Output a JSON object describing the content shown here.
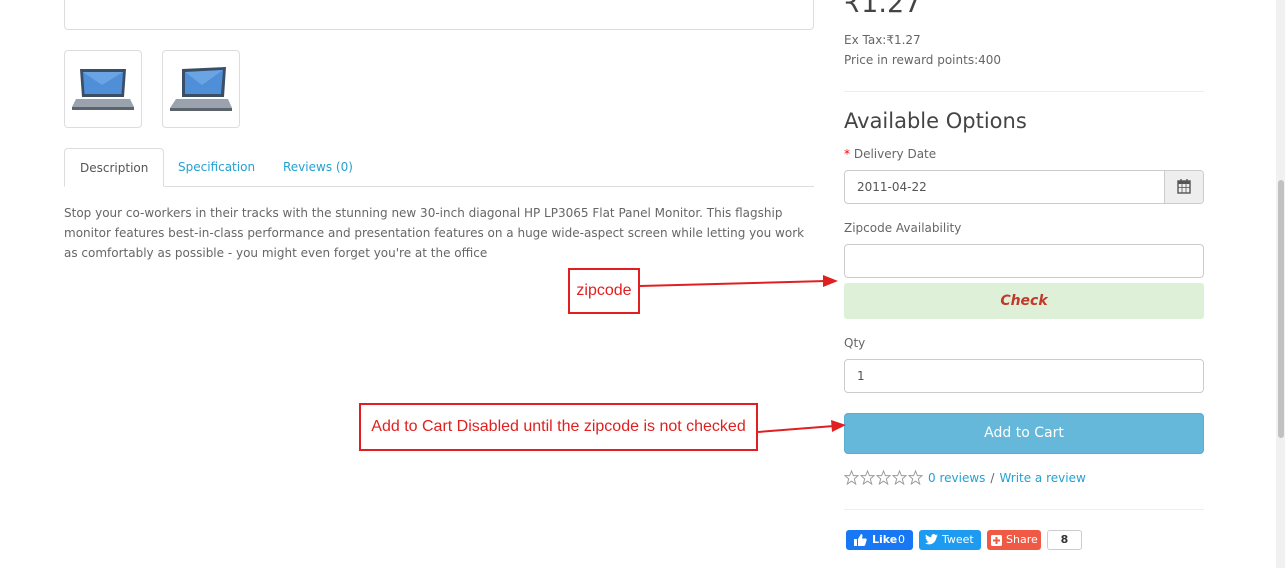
{
  "gallery": {
    "thumb_icon_1": "laptop-icon",
    "thumb_icon_2": "laptop-icon"
  },
  "tabs": [
    {
      "label": "Description",
      "active": true
    },
    {
      "label": "Specification",
      "active": false
    },
    {
      "label": "Reviews (0)",
      "active": false
    }
  ],
  "description": "Stop your co-workers in their tracks with the stunning new 30-inch diagonal HP LP3065 Flat Panel Monitor. This flagship monitor features best-in-class performance and presentation features on a huge wide-aspect screen while letting you work as comfortably as possible - you might even forget you're at the office",
  "product": {
    "price": "₹1.27",
    "ex_tax": "Ex Tax:₹1.27",
    "reward_points": "Price in reward points:400"
  },
  "options": {
    "title": "Available Options",
    "required_mark": "*",
    "delivery_label": "Delivery Date",
    "delivery_value": "2011-04-22",
    "calendar_icon": "calendar-icon",
    "zipcode_label": "Zipcode Availability",
    "zipcode_value": "",
    "check_label": "Check",
    "qty_label": "Qty",
    "qty_value": "1",
    "add_to_cart_label": "Add to Cart"
  },
  "rating": {
    "stars_filled": 0,
    "stars_total": 5,
    "reviews_link": "0 reviews",
    "separator": "/",
    "write_review_link": "Write a review"
  },
  "share": {
    "like_label": "Like",
    "like_count": "0",
    "tweet_label": "Tweet",
    "share_label": "Share",
    "share_count": "8"
  },
  "annotations": {
    "zipcode": "zipcode",
    "cart_note": "Add to Cart Disabled until the zipcode is not checked"
  },
  "colors": {
    "link": "#23a1d1",
    "check_bg": "#dff0d8",
    "cart_bg": "#66b8da",
    "annotation": "#e02020"
  }
}
